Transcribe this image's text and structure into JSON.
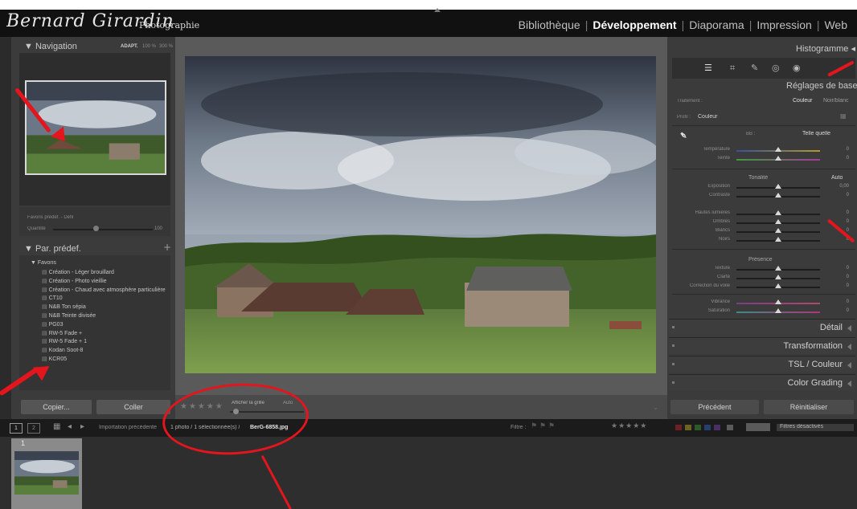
{
  "branding": {
    "script": "Bernard Girardin",
    "sub": "Photographie"
  },
  "modules": [
    "Bibliothèque",
    "Développement",
    "Diaporama",
    "Impression",
    "Web"
  ],
  "active_module": "Développement",
  "left": {
    "navigation": {
      "title": "Navigation",
      "zoom": [
        "ADAPT.",
        "100 %",
        "300 %"
      ]
    },
    "saved": {
      "title": "Favoris prédéf. - Défil",
      "label": "Quantité",
      "value": "100"
    },
    "presets": {
      "title": "Par. prédef.",
      "group": "Favoris",
      "items": [
        "Création - Léger brouillard",
        "Création - Photo vieillie",
        "Création - Chaud avec atmosphère particulière",
        "CT10",
        "N&B Ton sépia",
        "N&B Teinte divisée",
        "PG03",
        "RW-5 Fade +",
        "RW-5 Fade + 1",
        "Kodan Soot-8",
        "KCR05"
      ]
    },
    "buttons": {
      "copy": "Copier...",
      "paste": "Coller"
    }
  },
  "toolbar": {
    "grid_label": "Afficher la grille",
    "extra": "Auto",
    "stars": "★★★★★"
  },
  "right": {
    "histogram": "Histogramme",
    "basic": "Réglages de base",
    "treatment": {
      "label": "Traitement :",
      "color": "Couleur",
      "bw": "Noir/blanc"
    },
    "profile": {
      "label": "Profil :",
      "value": "Couleur"
    },
    "wb": {
      "label": "BB :",
      "value": "Telle quelle"
    },
    "sliders_wb": [
      {
        "label": "Température",
        "value": "0"
      },
      {
        "label": "Teinte",
        "value": "0"
      }
    ],
    "tone_title": "Tonalité",
    "tone_auto": "Auto",
    "sliders_tone": [
      {
        "label": "Exposition",
        "value": "0,00"
      },
      {
        "label": "Contraste",
        "value": "0"
      }
    ],
    "sliders_tone2": [
      {
        "label": "Hautes lumières",
        "value": "0"
      },
      {
        "label": "Ombres",
        "value": "0"
      },
      {
        "label": "Blancs",
        "value": "0"
      },
      {
        "label": "Noirs",
        "value": "0"
      }
    ],
    "presence_title": "Présence",
    "sliders_presence": [
      {
        "label": "Texture",
        "value": "0"
      },
      {
        "label": "Clarté",
        "value": "0"
      },
      {
        "label": "Correction du voile",
        "value": "0"
      }
    ],
    "sliders_vib": [
      {
        "label": "Vibrance",
        "value": "0"
      },
      {
        "label": "Saturation",
        "value": "0"
      }
    ],
    "sections": [
      "Détail",
      "Transformation",
      "TSL / Couleur",
      "Color Grading"
    ],
    "buttons": {
      "prev": "Précédent",
      "reset": "Réinitialiser"
    }
  },
  "filmbar": {
    "breadcrumb_source": "Importation précédente",
    "breadcrumb_count": "1 photo / 1 sélectionnée(s) /",
    "filename": "BerG-6858.jpg",
    "filter_label": "Filtre :",
    "filters_off": "Filtres désactivés",
    "pages": [
      "1",
      "2"
    ]
  },
  "filmstrip": {
    "index": "1"
  },
  "colors": {
    "accent": "#e4151d",
    "panel": "#3b3b3b",
    "topbar": "#111111"
  }
}
